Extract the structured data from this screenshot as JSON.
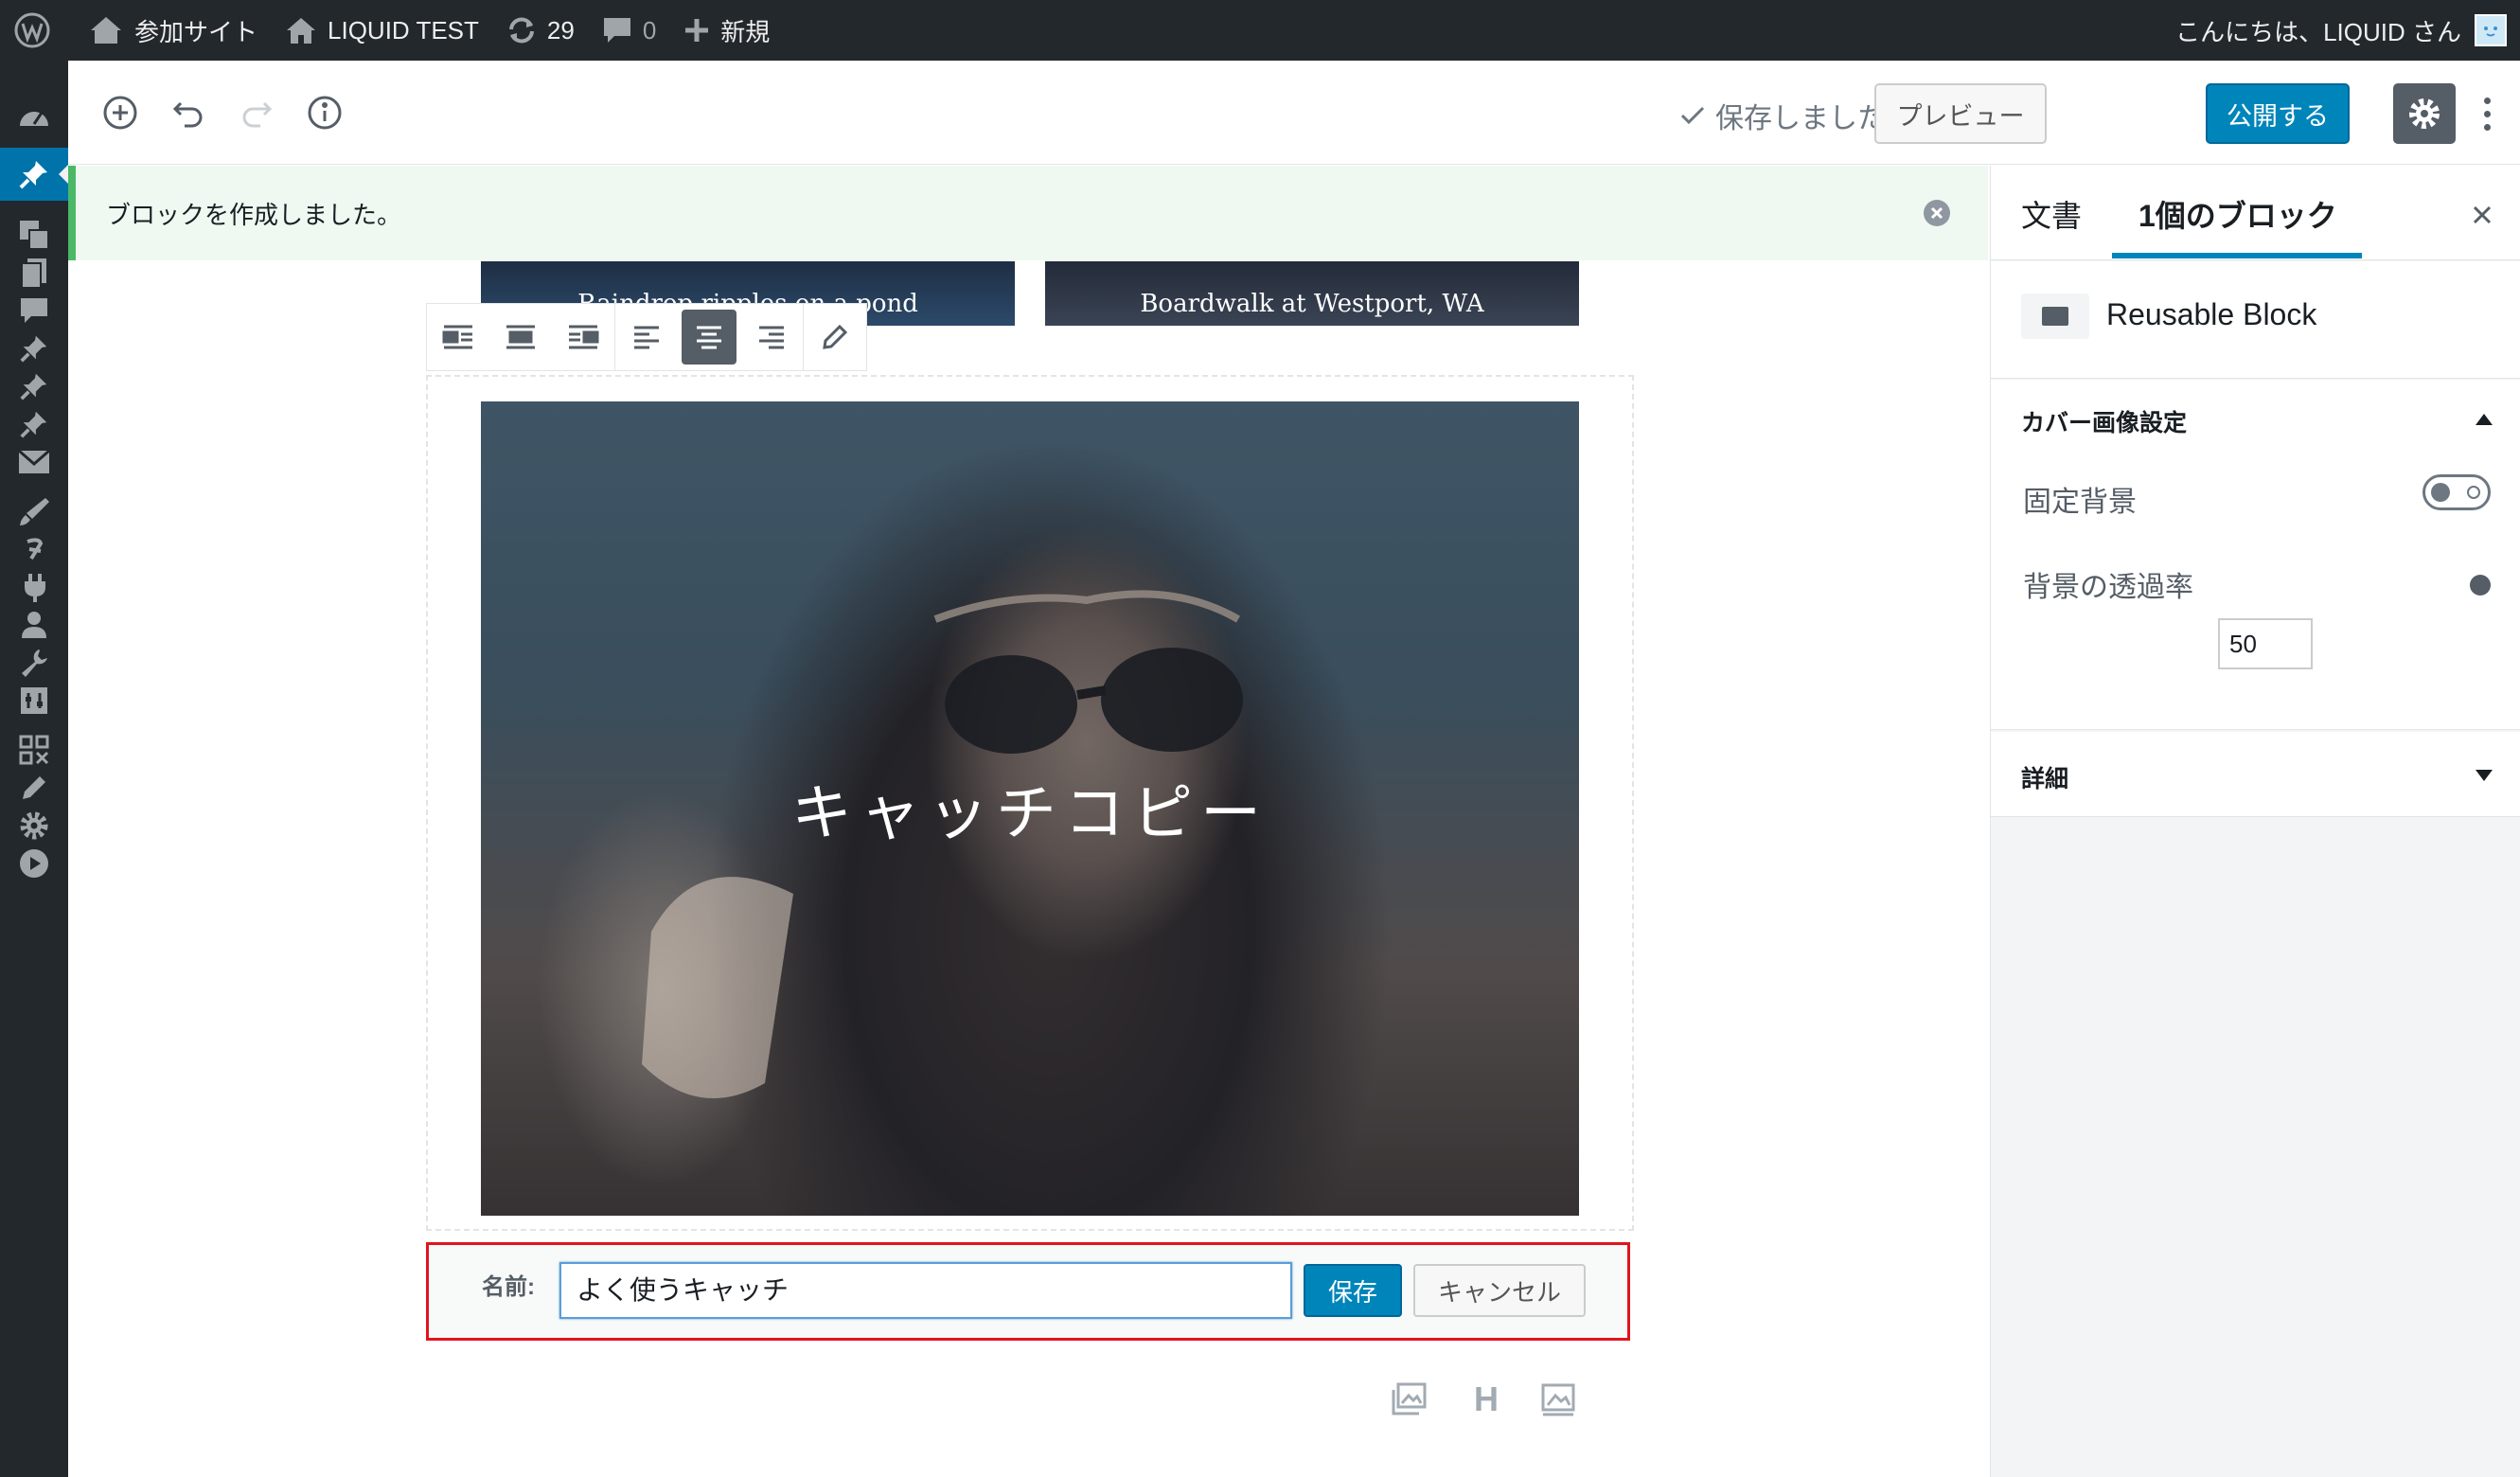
{
  "adminbar": {
    "wp_label": "WordPress",
    "sites_label": "参加サイト",
    "site_label": "LIQUID TEST",
    "updates_count": "29",
    "comments_count": "0",
    "new_label": "新規",
    "greeting": "こんにちは、LIQUID さん"
  },
  "header": {
    "saved_label": "保存しました",
    "preview_label": "プレビュー",
    "publish_label": "公開する"
  },
  "notice": {
    "text": "ブロックを作成しました。"
  },
  "gallery": {
    "captions": [
      "Raindrop ripples on a pond",
      "Boardwalk at Westport, WA"
    ]
  },
  "cover": {
    "title": "キャッチコピー"
  },
  "reusable_form": {
    "name_label": "名前:",
    "name_value": "よく使うキャッチ",
    "save_label": "保存",
    "cancel_label": "キャンセル"
  },
  "inserter": {
    "heading_label": "H"
  },
  "sidebar": {
    "tab_document": "文書",
    "tab_block": "1個のブロック",
    "block_card_title": "Reusable Block",
    "panel_cover_title": "カバー画像設定",
    "fixed_bg_label": "固定背景",
    "fixed_bg_enabled": false,
    "opacity_label": "背景の透過率",
    "opacity_value": "50",
    "panel_advanced_title": "詳細"
  },
  "colors": {
    "admin_bar": "#23282d",
    "accent": "#0085ba",
    "notice_border": "#4ab866",
    "highlight": "#e0141e"
  }
}
